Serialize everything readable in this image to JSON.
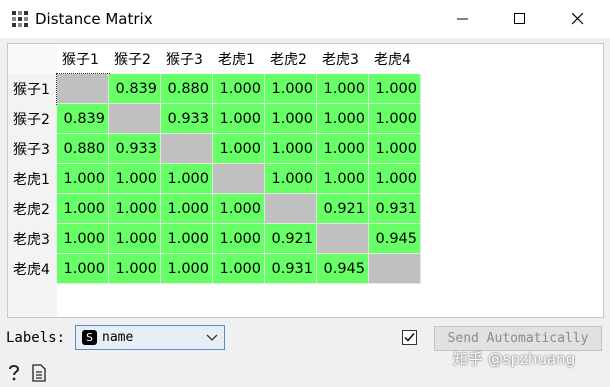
{
  "window": {
    "title": "Distance Matrix"
  },
  "matrix": {
    "labels": [
      "猴子1",
      "猴子2",
      "猴子3",
      "老虎1",
      "老虎2",
      "老虎3",
      "老虎4"
    ],
    "values": [
      [
        null,
        "0.839",
        "0.880",
        "1.000",
        "1.000",
        "1.000",
        "1.000"
      ],
      [
        "0.839",
        null,
        "0.933",
        "1.000",
        "1.000",
        "1.000",
        "1.000"
      ],
      [
        "0.880",
        "0.933",
        null,
        "1.000",
        "1.000",
        "1.000",
        "1.000"
      ],
      [
        "1.000",
        "1.000",
        "1.000",
        null,
        "1.000",
        "1.000",
        "1.000"
      ],
      [
        "1.000",
        "1.000",
        "1.000",
        "1.000",
        null,
        "0.921",
        "0.931"
      ],
      [
        "1.000",
        "1.000",
        "1.000",
        "1.000",
        "0.921",
        null,
        "0.945"
      ],
      [
        "1.000",
        "1.000",
        "1.000",
        "1.000",
        "0.931",
        "0.945",
        null
      ]
    ]
  },
  "controls": {
    "labels_caption": "Labels:",
    "labels_value": "name",
    "labels_badge": "S",
    "send_automatically_checked": true,
    "send_label": "Send Automatically"
  },
  "watermark": "知乎 @spzhuang",
  "colors": {
    "cell_green": "#66ff66",
    "diagonal_gray": "#c0c0c0"
  }
}
